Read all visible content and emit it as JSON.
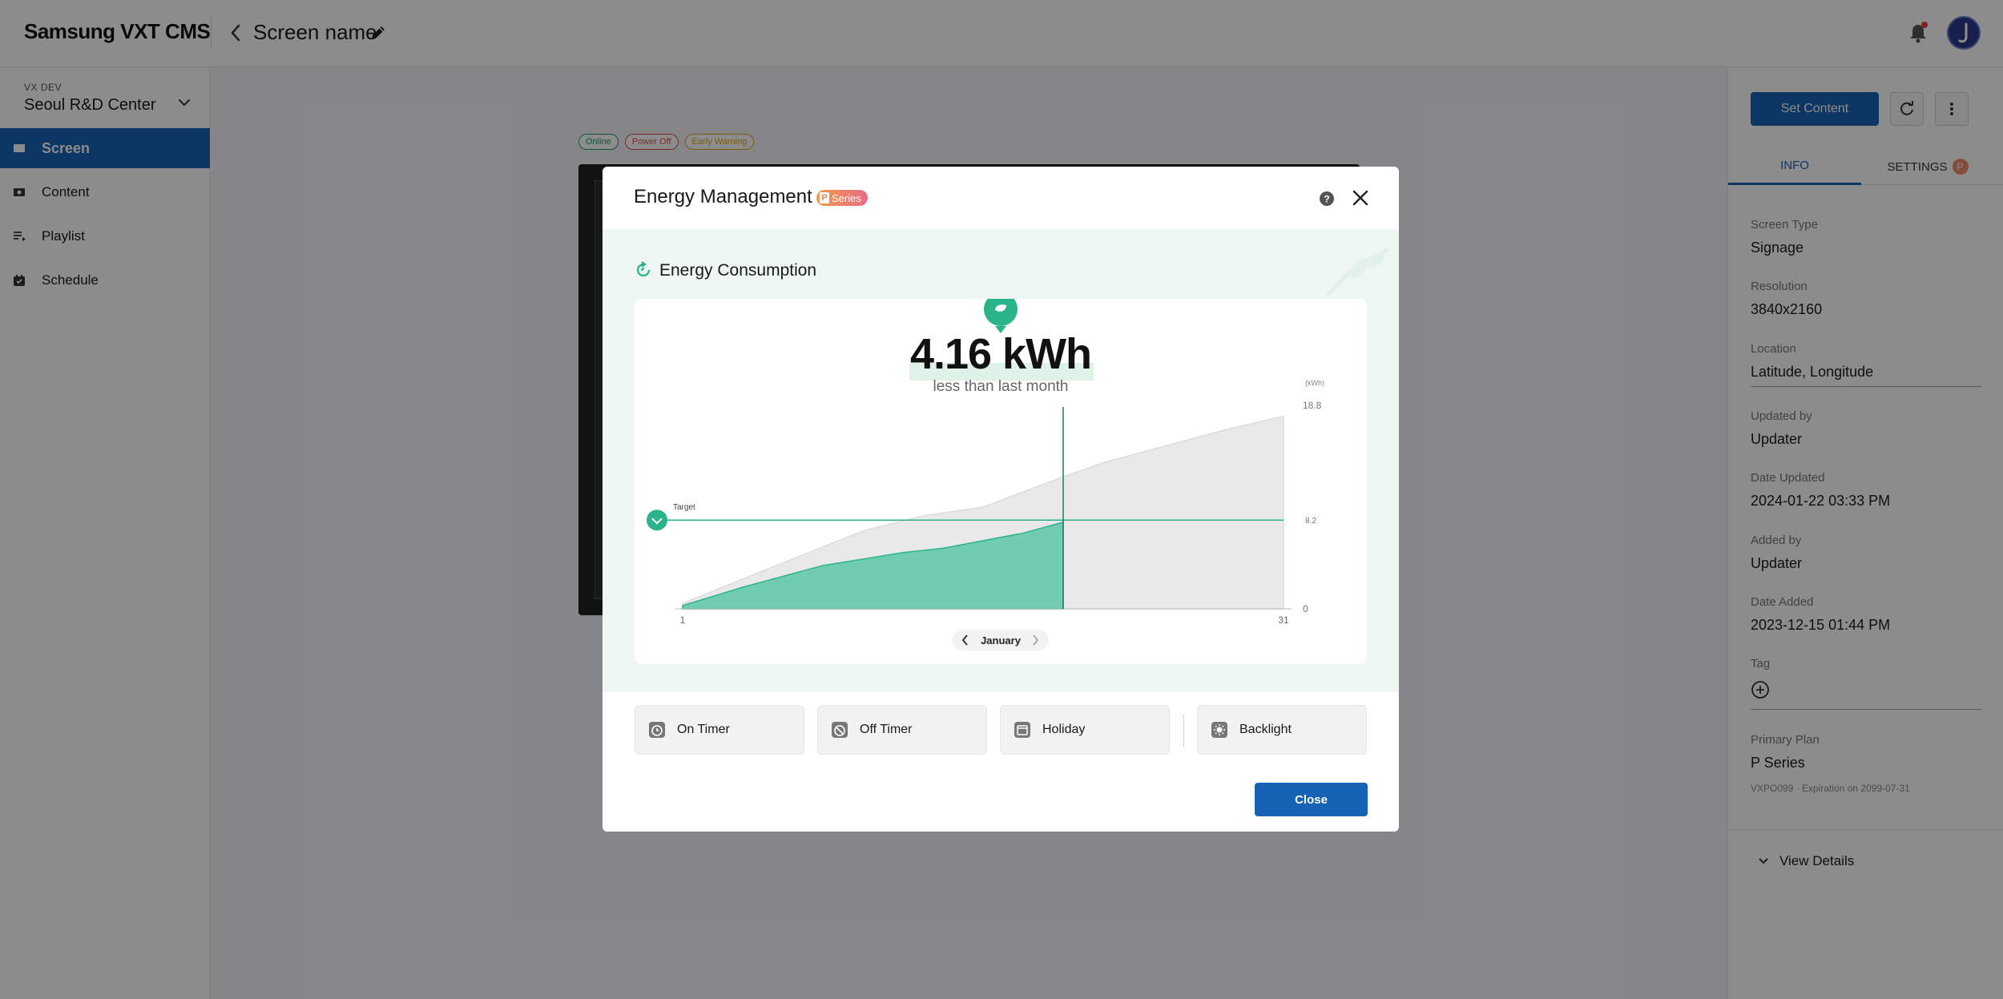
{
  "app": {
    "brand": "Samsung VXT CMS",
    "screen_title": "Screen name"
  },
  "sidebar": {
    "org_small": "VX DEV",
    "org_name": "Seoul R&D Center",
    "items": [
      {
        "label": "Screen",
        "icon": "screen-icon",
        "active": true
      },
      {
        "label": "Content",
        "icon": "content-icon",
        "active": false
      },
      {
        "label": "Playlist",
        "icon": "playlist-icon",
        "active": false
      },
      {
        "label": "Schedule",
        "icon": "schedule-icon",
        "active": false
      }
    ]
  },
  "main": {
    "status_chips": [
      "Online",
      "Power Off",
      "Early Warning"
    ]
  },
  "right_panel": {
    "set_content_label": "Set Content",
    "tabs": [
      {
        "label": "INFO",
        "active": true
      },
      {
        "label": "SETTINGS",
        "badge": "P",
        "active": false
      }
    ],
    "info": [
      {
        "label": "Screen Type",
        "value": "Signage"
      },
      {
        "label": "Resolution",
        "value": "3840x2160"
      },
      {
        "label": "Location",
        "value": "Latitude, Longitude"
      },
      {
        "label": "Updated by",
        "value": "Updater"
      },
      {
        "label": "Date Updated",
        "value": "2024-01-22 03:33 PM"
      },
      {
        "label": "Added by",
        "value": "Updater"
      },
      {
        "label": "Date Added",
        "value": "2023-12-15 01:44 PM"
      },
      {
        "label": "Tag",
        "value": ""
      },
      {
        "label": "Primary Plan",
        "value": "P Series"
      }
    ],
    "plan_meta": "VXPO099 · Expiration on 2099-07-31",
    "view_details": "View Details"
  },
  "modal": {
    "title": "Energy Management",
    "series_badge": {
      "letter": "P",
      "text": "Series"
    },
    "section_title": "Energy Consumption",
    "kwh_value": "4.16 kWh",
    "kwh_sub": "less than last month",
    "month": "January",
    "buttons": [
      {
        "label": "On Timer"
      },
      {
        "label": "Off Timer"
      },
      {
        "label": "Holiday"
      },
      {
        "label": "Backlight"
      }
    ],
    "close_label": "Close",
    "colors": {
      "accent": "#1663b5",
      "green": "#2bb38a",
      "green_fill": "#72cdb0",
      "gray_fill": "#e9e9e9"
    }
  },
  "chart_data": {
    "type": "area",
    "unit_label": "(kWh)",
    "x_ticks": [
      "1",
      "31"
    ],
    "y_ticks": [
      "0",
      "8.2",
      "18.8"
    ],
    "target_label": "Target",
    "target_value": 8.2,
    "ylim": [
      0,
      18.8
    ],
    "current_day": 20,
    "series": [
      {
        "x": [
          1,
          5,
          10,
          13,
          16,
          18,
          20,
          22,
          25,
          28,
          31
        ],
        "values": [
          0.5,
          3.5,
          7.2,
          8.6,
          9.4,
          10.8,
          12.2,
          13.5,
          15.0,
          16.5,
          17.8
        ]
      },
      {
        "x": [
          1,
          4,
          8,
          12,
          14,
          16,
          18,
          20
        ],
        "values": [
          0.3,
          2.0,
          4.0,
          5.2,
          5.6,
          6.3,
          7.0,
          8.0
        ]
      }
    ]
  }
}
